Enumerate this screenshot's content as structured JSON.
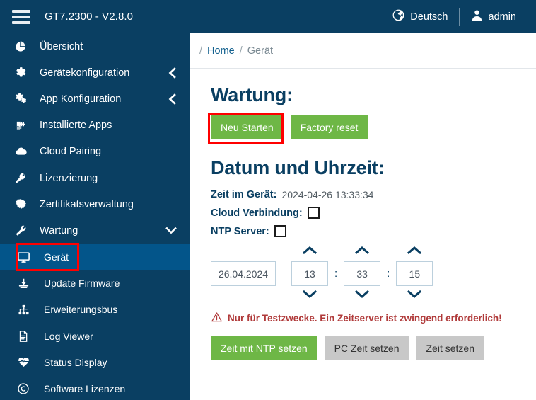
{
  "colors": {
    "brand_navy": "#0a3f62",
    "active_blue": "#03558a",
    "green": "#6eb746",
    "grey_button": "#c8c8c8",
    "warning_red": "#b03a3a",
    "highlight_red": "#ff0000",
    "link_blue": "#15628f"
  },
  "topbar": {
    "menu_icon": "hamburger-icon",
    "title": "GT7.2300 - V2.8.0",
    "language": {
      "icon": "globe-icon",
      "label": "Deutsch"
    },
    "user": {
      "icon": "user-icon",
      "label": "admin"
    }
  },
  "sidebar": {
    "items": [
      {
        "icon": "pie-chart-icon",
        "label": "Übersicht",
        "chevron": "",
        "active": false,
        "sub": false
      },
      {
        "icon": "gear-icon",
        "label": "Gerätekonfiguration",
        "chevron": "left",
        "active": false,
        "sub": false
      },
      {
        "icon": "gears-icon",
        "label": "App Konfiguration",
        "chevron": "left",
        "active": false,
        "sub": false
      },
      {
        "icon": "puzzle-plug-icon",
        "label": "Installierte Apps",
        "chevron": "",
        "active": false,
        "sub": false
      },
      {
        "icon": "cloud-icon",
        "label": "Cloud Pairing",
        "chevron": "",
        "active": false,
        "sub": false
      },
      {
        "icon": "key-icon",
        "label": "Lizenzierung",
        "chevron": "",
        "active": false,
        "sub": false
      },
      {
        "icon": "certificate-icon",
        "label": "Zertifikatsverwaltung",
        "chevron": "",
        "active": false,
        "sub": false
      },
      {
        "icon": "wrench-icon",
        "label": "Wartung",
        "chevron": "down",
        "active": false,
        "sub": false
      },
      {
        "icon": "monitor-icon",
        "label": "Gerät",
        "chevron": "",
        "active": true,
        "sub": true
      },
      {
        "icon": "download-icon",
        "label": "Update Firmware",
        "chevron": "",
        "active": false,
        "sub": true
      },
      {
        "icon": "sitemap-icon",
        "label": "Erweiterungsbus",
        "chevron": "",
        "active": false,
        "sub": true
      },
      {
        "icon": "file-text-icon",
        "label": "Log Viewer",
        "chevron": "",
        "active": false,
        "sub": true
      },
      {
        "icon": "heartbeat-icon",
        "label": "Status Display",
        "chevron": "",
        "active": false,
        "sub": true
      },
      {
        "icon": "copyright-icon",
        "label": "Software Lizenzen",
        "chevron": "",
        "active": false,
        "sub": true
      }
    ]
  },
  "breadcrumb": {
    "sep": "/",
    "home": "Home",
    "current": "Gerät"
  },
  "main": {
    "maintenance": {
      "heading": "Wartung:",
      "restart_button": "Neu Starten",
      "factory_reset_button": "Factory reset"
    },
    "datetime": {
      "heading": "Datum und Uhrzeit:",
      "device_time_label": "Zeit im Gerät:",
      "device_time_value": "2024-04-26 13:33:34",
      "cloud_connection_label": "Cloud Verbindung:",
      "cloud_connection_checked": false,
      "ntp_server_label": "NTP Server:",
      "ntp_server_checked": false,
      "date_value": "26.04.2024",
      "hours_value": "13",
      "minutes_value": "33",
      "seconds_value": "15",
      "time_separator": ":",
      "up_chevron": "chevron-up-icon",
      "down_chevron": "chevron-down-icon",
      "warning_icon": "warning-triangle-icon",
      "warning_text": "Nur für Testzwecke. Ein Zeitserver ist zwingend erforderlich!",
      "set_ntp_button": "Zeit mit NTP setzen",
      "set_pc_time_button": "PC Zeit setzen",
      "set_time_button": "Zeit setzen"
    }
  }
}
